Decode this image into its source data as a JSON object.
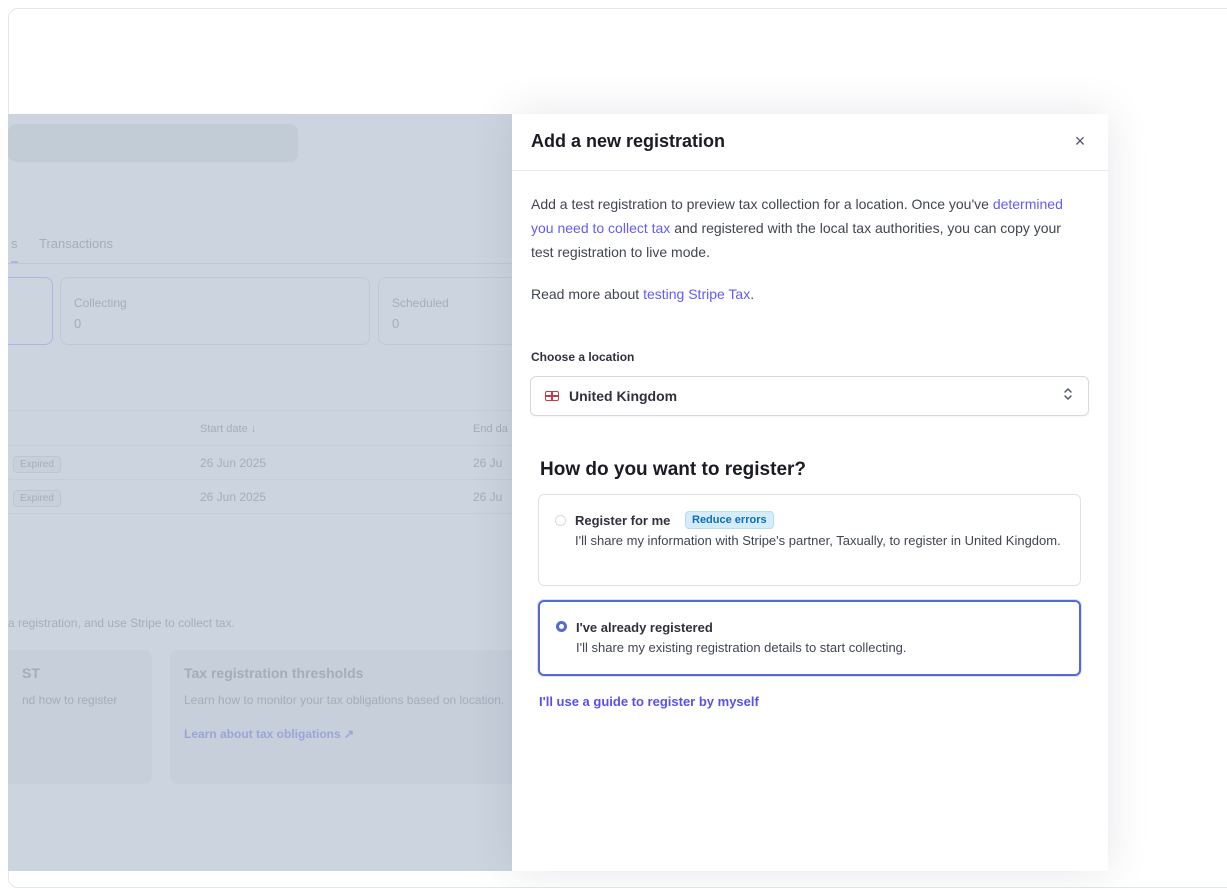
{
  "background": {
    "tabs": [
      "s",
      "Transactions"
    ],
    "cards": [
      {
        "label": "Collecting",
        "value": "0"
      },
      {
        "label": "Scheduled",
        "value": "0"
      }
    ],
    "table": {
      "headers": [
        "Start date ↓",
        "End da"
      ],
      "rows": [
        {
          "status": "Expired",
          "start": "26 Jun 2025",
          "end": "26 Ju"
        },
        {
          "status": "Expired",
          "start": "26 Jun 2025",
          "end": "26 Ju"
        }
      ]
    },
    "description": "a registration, and use Stripe to collect tax.",
    "tiles": [
      {
        "title": "ST",
        "body": "nd how to register",
        "link": ""
      },
      {
        "title": "Tax registration thresholds",
        "body": "Learn how to monitor your tax obligations based on location.",
        "link": "Learn about tax obligations ↗"
      }
    ]
  },
  "panel": {
    "title": "Add a new registration",
    "close_label": "×",
    "intro_before": "Add a test registration to preview tax collection for a location. Once you've ",
    "intro_link": "determined you need to collect tax",
    "intro_after": " and registered with the local tax authorities, you can copy your test registration to live mode.",
    "readmore_before": "Read more about ",
    "readmore_link": "testing Stripe Tax",
    "readmore_after": ".",
    "location_label": "Choose a location",
    "location_value": "United Kingdom",
    "select_arrow": "⌃⌄",
    "question": "How do you want to register?",
    "options": [
      {
        "title": "Register for me",
        "tag": "Reduce errors",
        "description": "I'll share my information with Stripe's partner, Taxually, to register in United Kingdom.",
        "selected": false
      },
      {
        "title": "I've already registered",
        "description": "I'll share my existing registration details to start collecting.",
        "selected": true
      }
    ],
    "guide_link": "I'll use a guide to register by myself"
  },
  "colors": {
    "accent": "#635bff",
    "selected_border": "#5469d4",
    "overlay": "#ccd5df"
  }
}
